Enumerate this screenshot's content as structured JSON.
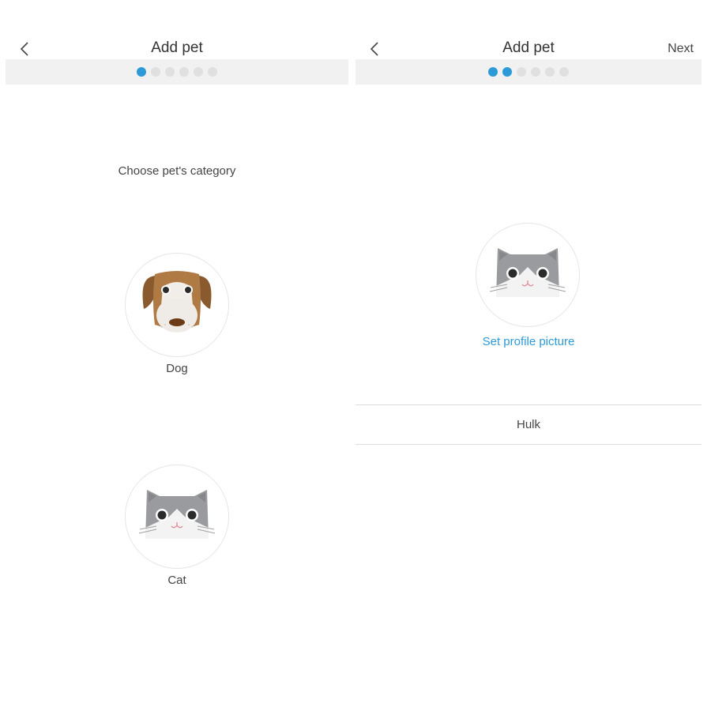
{
  "left_screen": {
    "title": "Add pet",
    "back_icon": "chevron-left-icon",
    "progress": {
      "total": 6,
      "current": 1
    },
    "prompt": "Choose pet's category",
    "categories": [
      {
        "label": "Dog",
        "icon": "dog-icon"
      },
      {
        "label": "Cat",
        "icon": "cat-icon"
      }
    ]
  },
  "right_screen": {
    "title": "Add pet",
    "next_label": "Next",
    "back_icon": "chevron-left-icon",
    "progress": {
      "total": 6,
      "current": 2
    },
    "avatar_icon": "cat-icon",
    "set_picture_label": "Set profile picture",
    "name_value": "Hulk"
  },
  "colors": {
    "accent": "#2d9ad8",
    "dot_inactive": "#e0e0e0",
    "strip_bg": "#f1f1f1",
    "dog_brown": "#a8713e",
    "cat_gray": "#9a9c9f"
  }
}
